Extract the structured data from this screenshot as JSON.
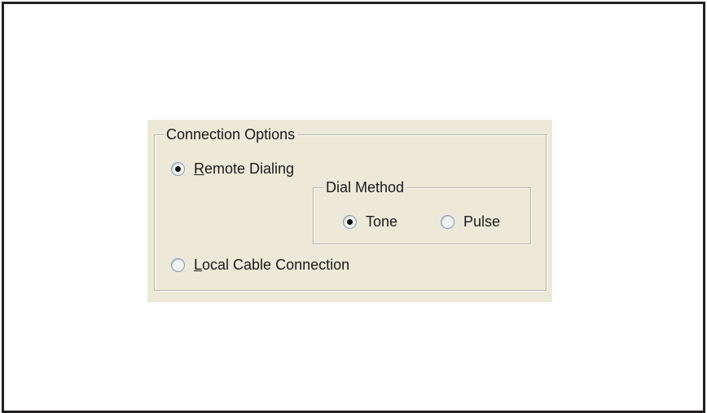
{
  "connection_options": {
    "title": "Connection Options",
    "remote_dialing": {
      "mnemonic": "R",
      "rest": "emote Dialing",
      "checked": true
    },
    "local_cable": {
      "mnemonic": "L",
      "rest": "ocal Cable Connection",
      "checked": false
    },
    "dial_method": {
      "title": "Dial Method",
      "tone": {
        "label": "Tone",
        "checked": true
      },
      "pulse": {
        "label": "Pulse",
        "checked": false
      }
    }
  },
  "colors": {
    "dialog_background": "#ece9d8",
    "frame_border": "#231f20",
    "groupbox_border": "#b5b3a6",
    "radio_border": "#7f9db9"
  }
}
